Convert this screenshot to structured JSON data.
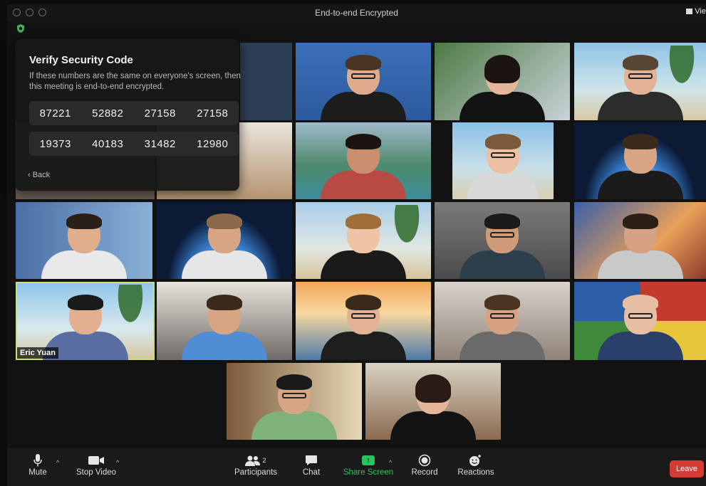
{
  "window": {
    "title": "End-to-end Encrypted",
    "view_label": "Vie"
  },
  "security_panel": {
    "heading": "Verify Security Code",
    "description": "If these numbers are the same on everyone's screen, then this meeting is end-to-end encrypted.",
    "code_row_1": [
      "87221",
      "52882",
      "27158",
      "27158"
    ],
    "code_row_2": [
      "19373",
      "40183",
      "31482",
      "12980"
    ],
    "back_label": "‹ Back"
  },
  "active_speaker": {
    "name": "Eric Yuan"
  },
  "participant_count": "2",
  "toolbar": {
    "mute": "Mute",
    "stop_video": "Stop Video",
    "participants": "Participants",
    "chat": "Chat",
    "share_screen": "Share Screen",
    "record": "Record",
    "reactions": "Reactions",
    "leave": "Leave"
  },
  "colors": {
    "share_accent": "#29c25f",
    "leave_red": "#d43b33",
    "active_outline": "#c9e07a",
    "shield_green": "#3bb55c"
  }
}
